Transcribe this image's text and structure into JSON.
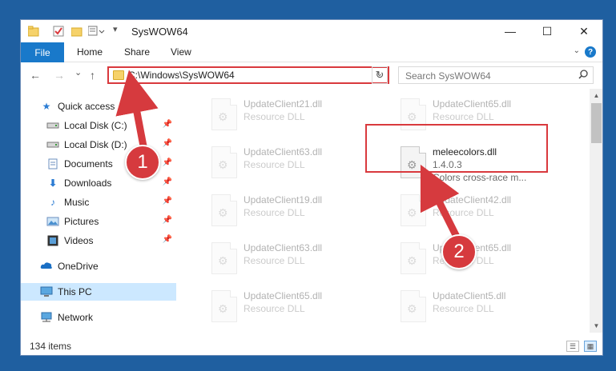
{
  "titlebar": {
    "title": "SysWOW64",
    "minimize": "—",
    "maximize": "☐",
    "close": "✕"
  },
  "ribbon": {
    "file": "File",
    "home": "Home",
    "share": "Share",
    "view": "View",
    "help": "?"
  },
  "nav": {
    "back": "←",
    "forward": "→",
    "recent": "⌄",
    "up": "↑",
    "refresh": "↻",
    "address_chevron": "⌄"
  },
  "address": {
    "path": "C:\\Windows\\SysWOW64"
  },
  "search": {
    "placeholder": "Search SysWOW64",
    "icon": "search-icon"
  },
  "sidebar": {
    "items": [
      {
        "label": "Quick access",
        "icon": "star-icon"
      },
      {
        "label": "Local Disk (C:)",
        "icon": "drive-icon"
      },
      {
        "label": "Local Disk (D:)",
        "icon": "drive-icon"
      },
      {
        "label": "Documents",
        "icon": "documents-icon"
      },
      {
        "label": "Downloads",
        "icon": "downloads-icon"
      },
      {
        "label": "Music",
        "icon": "music-icon"
      },
      {
        "label": "Pictures",
        "icon": "pictures-icon"
      },
      {
        "label": "Videos",
        "icon": "videos-icon"
      },
      {
        "label": "OneDrive",
        "icon": "cloud-icon"
      },
      {
        "label": "This PC",
        "icon": "computer-icon"
      },
      {
        "label": "Network",
        "icon": "network-icon"
      }
    ]
  },
  "files": [
    {
      "name": "UpdateClient21.dll",
      "desc": "Resource DLL"
    },
    {
      "name": "UpdateClient65.dll",
      "desc": "Resource DLL"
    },
    {
      "name": "UpdateClient63.dll",
      "desc": "Resource DLL"
    },
    {
      "name": "meleecolors.dll",
      "version": "1.4.0.3",
      "desc": "Colors cross-race m..."
    },
    {
      "name": "UpdateClient19.dll",
      "desc": "Resource DLL"
    },
    {
      "name": "UpdateClient42.dll",
      "desc": "Resource DLL"
    },
    {
      "name": "UpdateClient63.dll",
      "desc": "Resource DLL"
    },
    {
      "name": "UpdateClient65.dll",
      "desc": "Resource DLL"
    },
    {
      "name": "UpdateClient65.dll",
      "desc": "Resource DLL"
    },
    {
      "name": "UpdateClient5.dll",
      "desc": "Resource DLL"
    }
  ],
  "status": {
    "count": "134 items"
  },
  "annotations": {
    "badge1": "1",
    "badge2": "2",
    "accent": "#d63a3e"
  },
  "colors": {
    "desktop": "#1f5fa0",
    "file_tab": "#1979ca",
    "selection": "#cce8ff"
  }
}
